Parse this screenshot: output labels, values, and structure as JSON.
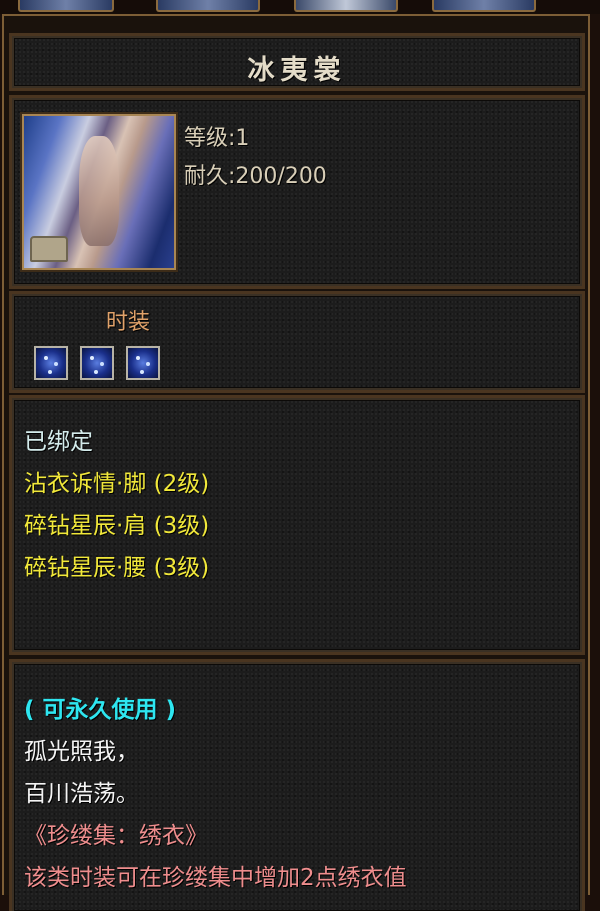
{
  "item": {
    "name": "冰夷裳",
    "level_label": "等级:1",
    "durability_label": "耐久:200/200",
    "icon": "costume-robe-icon"
  },
  "fashion": {
    "label": "时装",
    "sockets": [
      {
        "icon": "star-gem-icon"
      },
      {
        "icon": "star-gem-icon"
      },
      {
        "icon": "star-gem-icon"
      }
    ]
  },
  "attributes": {
    "bound": "已绑定",
    "lines": [
      "沾衣诉情·脚 (2级)",
      "碎钻星辰·肩 (3级)",
      "碎钻星辰·腰 (3级)"
    ]
  },
  "description": {
    "usage": "( 可永久使用 )",
    "verse1": "孤光照我，",
    "verse2": "百川浩荡。",
    "collection": "《珍缕集：绣衣》",
    "effect": "该类时装可在珍缕集中增加2点绣衣值"
  },
  "colors": {
    "title": "#e4dcc8",
    "stat": "#d9cfb8",
    "fashion_label": "#e0a26a",
    "bound": "#d4ecec",
    "attribute": "#f1e83a",
    "usage": "#2ee6f0",
    "verse": "#f4f4f4",
    "collection": "#ee8d8d",
    "frame": "#7d5e36"
  }
}
